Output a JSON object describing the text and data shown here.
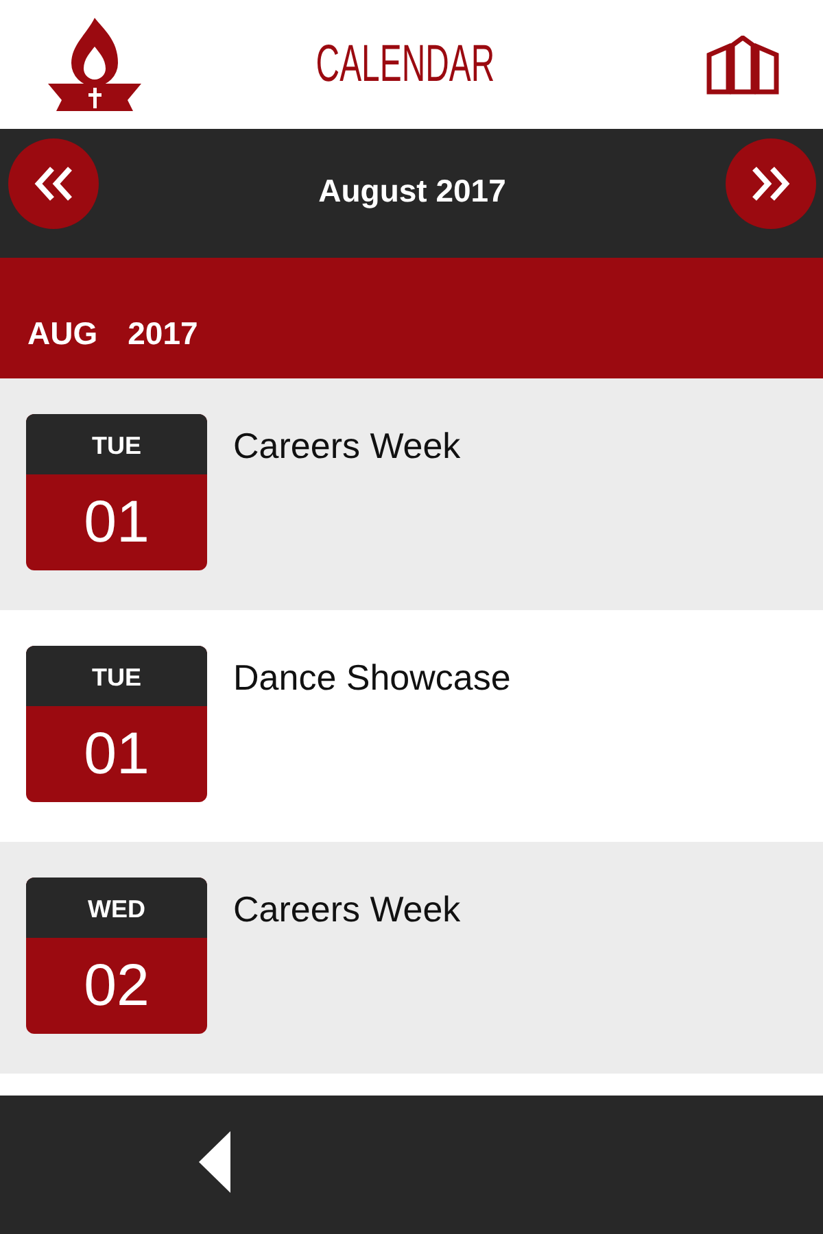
{
  "header": {
    "title": "CALENDAR"
  },
  "month_nav": {
    "label": "August 2017"
  },
  "section": {
    "month": "AUG",
    "year": "2017"
  },
  "events": [
    {
      "weekday": "TUE",
      "day": "01",
      "title": "Careers Week"
    },
    {
      "weekday": "TUE",
      "day": "01",
      "title": "Dance Showcase"
    },
    {
      "weekday": "WED",
      "day": "02",
      "title": "Careers Week"
    }
  ]
}
